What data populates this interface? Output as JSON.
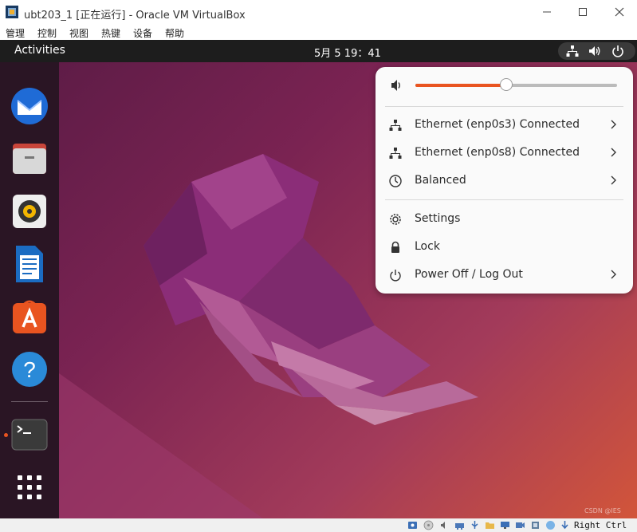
{
  "window": {
    "title": "ubt203_1 [正在运行] - Oracle VM VirtualBox",
    "icon": "virtualbox-icon",
    "controls": [
      "minimize",
      "maximize",
      "close"
    ]
  },
  "menubar": [
    "管理",
    "控制",
    "视图",
    "热键",
    "设备",
    "帮助"
  ],
  "topbar": {
    "activities": "Activities",
    "clock": "5月 5  19：41",
    "tray_icons": [
      "network-icon",
      "volume-icon",
      "power-icon"
    ]
  },
  "dock": {
    "apps": [
      "thunderbird-icon",
      "files-icon",
      "rhythmbox-icon",
      "libreoffice-writer-icon",
      "app-center-icon",
      "help-icon",
      "terminal-icon"
    ],
    "show_apps": "app-grid-icon",
    "running_app": "terminal"
  },
  "system_menu": {
    "volume_level": 0.45,
    "items": [
      {
        "label": "Ethernet (enp0s3) Connected",
        "icon": "network-wired-icon",
        "has_submenu": true
      },
      {
        "label": "Ethernet (enp0s8) Connected",
        "icon": "network-wired-icon",
        "has_submenu": true
      },
      {
        "label": "Balanced",
        "icon": "power-profile-icon",
        "has_submenu": true
      },
      {
        "label": "Settings",
        "icon": "settings-gear-icon",
        "has_submenu": false
      },
      {
        "label": "Lock",
        "icon": "lock-icon",
        "has_submenu": false
      },
      {
        "label": "Power Off / Log Out",
        "icon": "power-icon",
        "has_submenu": true
      }
    ]
  },
  "statusbar": {
    "host_key": "Right Ctrl",
    "watermark": "CSDN @IES"
  },
  "colors": {
    "accent": "#e95420",
    "topbar_bg": "#1d1d1d",
    "menu_bg": "#fafafa",
    "dock_bg": "#2a1524"
  }
}
